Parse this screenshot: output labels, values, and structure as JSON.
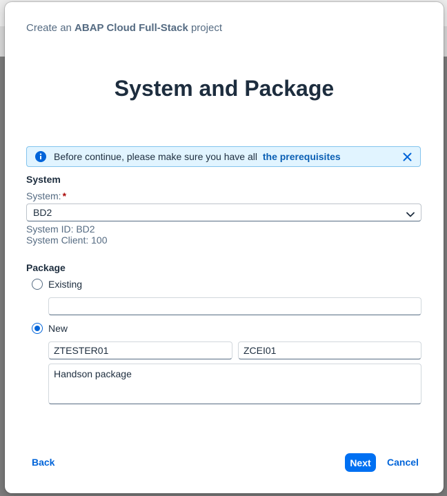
{
  "dialog": {
    "header_prefix": "Create an",
    "header_bold": "ABAP Cloud Full-Stack",
    "header_suffix": "project",
    "title": "System and Package"
  },
  "info_strip": {
    "text": "Before continue, please make sure you have all",
    "link": "the prerequisites",
    "icon": "info-icon",
    "close_icon": "close-icon"
  },
  "system_section": {
    "title": "System",
    "label": "System:",
    "required_mark": "*",
    "selected": "BD2",
    "system_id": "System ID: BD2",
    "system_client": "System Client: 100"
  },
  "package_section": {
    "title": "Package",
    "options": [
      {
        "label": "Existing",
        "selected": false
      },
      {
        "label": "New",
        "selected": true
      }
    ],
    "existing_value": "",
    "new_name": "ZTESTER01",
    "new_software_component": "ZCEI01",
    "new_description": "Handson package"
  },
  "footer": {
    "back": "Back",
    "next": "Next",
    "cancel": "Cancel"
  },
  "colors": {
    "accent": "#0070f2",
    "link": "#0a5fb4",
    "info_bg": "#e1f4ff"
  }
}
